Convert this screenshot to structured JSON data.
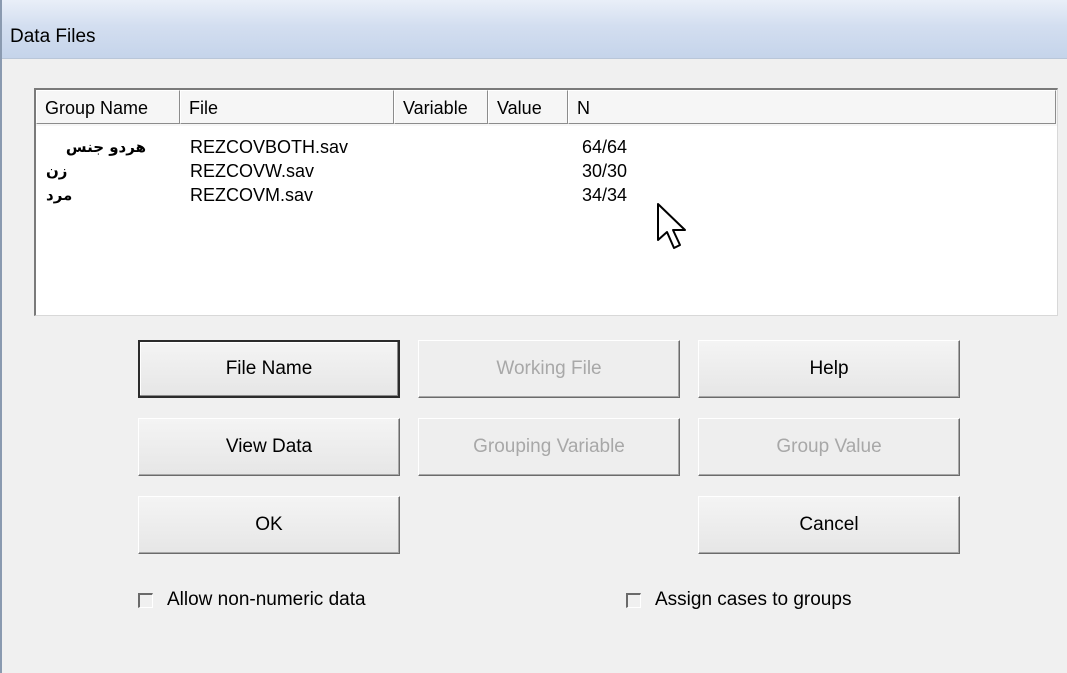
{
  "window": {
    "title": "Data Files"
  },
  "list": {
    "columns": [
      "Group Name",
      "File",
      "Variable",
      "Value",
      "N"
    ],
    "rows": [
      {
        "group": "هردو جنس",
        "file": "REZCOVBOTH.sav",
        "variable": "",
        "value": "",
        "n": "64/64"
      },
      {
        "group": "زن",
        "file": "REZCOVW.sav",
        "variable": "",
        "value": "",
        "n": "30/30"
      },
      {
        "group": "مرد",
        "file": "REZCOVM.sav",
        "variable": "",
        "value": "",
        "n": "34/34"
      }
    ]
  },
  "buttons": {
    "file_name": "File Name",
    "working_file": "Working File",
    "help": "Help",
    "view_data": "View Data",
    "grouping_variable": "Grouping Variable",
    "group_value": "Group Value",
    "ok": "OK",
    "cancel": "Cancel"
  },
  "options": {
    "allow_non_numeric": {
      "label": "Allow non-numeric data",
      "checked": false
    },
    "assign_cases": {
      "label": "Assign cases to groups",
      "checked": false
    }
  },
  "cursor": "arrow-cursor-icon"
}
